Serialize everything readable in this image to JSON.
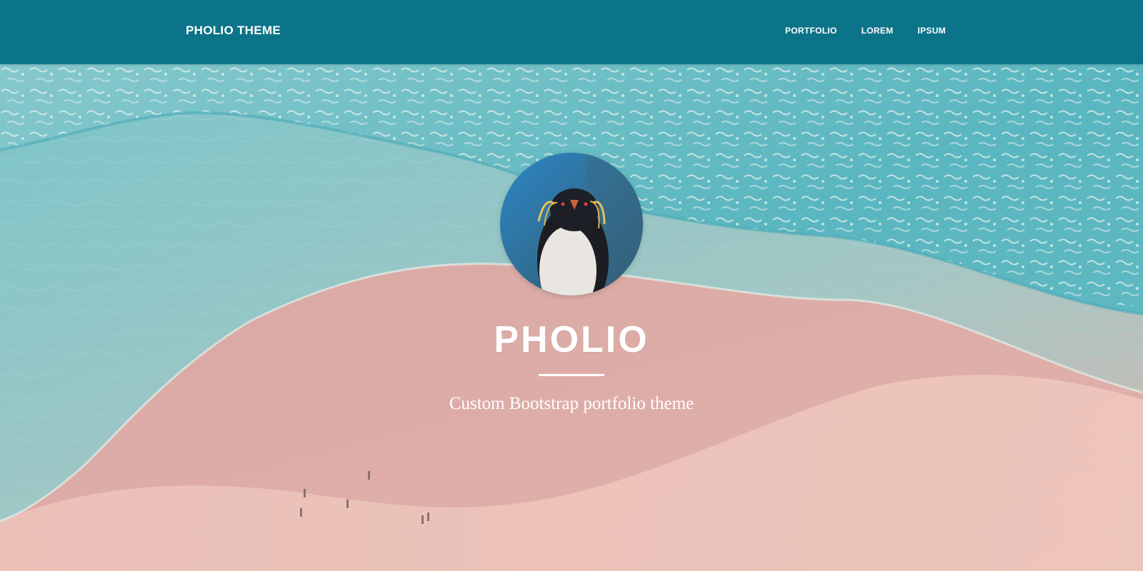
{
  "navbar": {
    "brand": "PHOLIO THEME",
    "links": [
      {
        "label": "PORTFOLIO"
      },
      {
        "label": "LOREM"
      },
      {
        "label": "IPSUM"
      }
    ],
    "background_color": "#0c7489"
  },
  "hero": {
    "title": "PHOLIO",
    "subtitle": "Custom Bootstrap portfolio theme",
    "avatar_icon": "penguin-avatar",
    "background_image": "beach-aerial-sand-waves"
  },
  "colors": {
    "accent": "#0c7489",
    "sand": "#e4b4ae",
    "sea": "#4fb5c2",
    "text": "#ffffff"
  }
}
